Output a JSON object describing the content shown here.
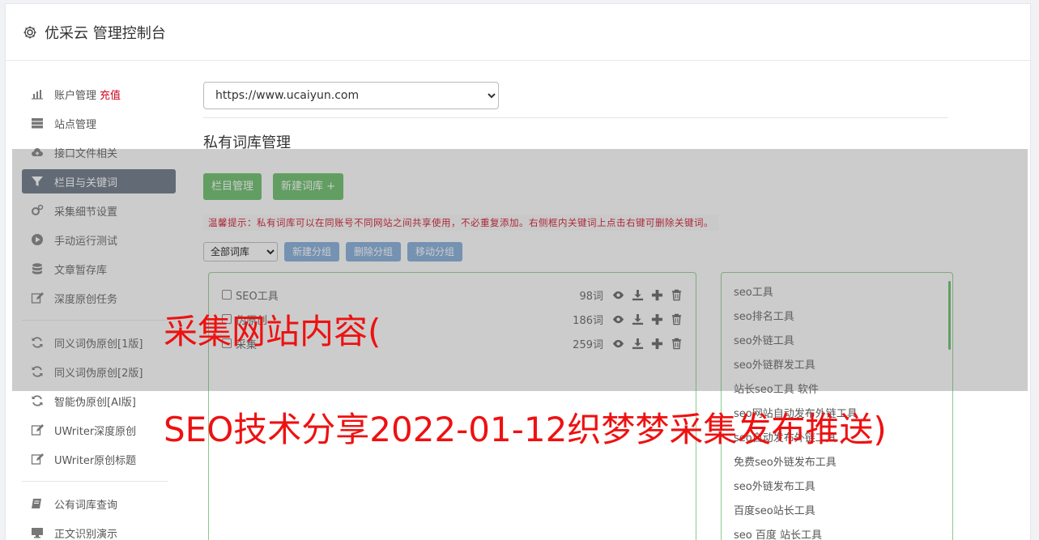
{
  "header": {
    "title": "优采云 管理控制台"
  },
  "sidebar": {
    "group1": [
      {
        "label": "账户管理",
        "extra": "充值",
        "icon": "bar-chart-icon"
      },
      {
        "label": "站点管理",
        "icon": "server-icon"
      },
      {
        "label": "接口文件相关",
        "icon": "cloud-upload-icon"
      },
      {
        "label": "栏目与关键词",
        "icon": "filter-icon",
        "active": true
      },
      {
        "label": "采集细节设置",
        "icon": "gears-icon"
      },
      {
        "label": "手动运行测试",
        "icon": "play-circle-icon"
      },
      {
        "label": "文章暂存库",
        "icon": "database-icon"
      },
      {
        "label": "深度原创任务",
        "icon": "edit-icon"
      }
    ],
    "group2": [
      {
        "label": "同义词伪原创[1版]",
        "icon": "refresh-icon"
      },
      {
        "label": "同义词伪原创[2版]",
        "icon": "refresh-icon"
      },
      {
        "label": "智能伪原创[AI版]",
        "icon": "refresh-icon"
      },
      {
        "label": "UWriter深度原创",
        "icon": "edit-icon"
      },
      {
        "label": "UWriter原创标题",
        "icon": "edit-icon"
      }
    ],
    "group3": [
      {
        "label": "公有词库查询",
        "icon": "book-icon"
      },
      {
        "label": "正文识别演示",
        "icon": "monitor-icon"
      }
    ]
  },
  "main": {
    "site_select": "https://www.ucaiyun.com",
    "section_title": "私有词库管理",
    "btn_columns": "栏目管理",
    "btn_new_lib": "新建词库 +",
    "tip": "温馨提示：私有词库可以在同账号不同网站之间共享使用，不必重复添加。右侧框内关键词上点击右键可删除关键词。",
    "lib_filter": "全部词库",
    "btn_new_group": "新建分组",
    "btn_delete_group": "删除分组",
    "btn_move_group": "移动分组",
    "libraries": [
      {
        "name": "SEO工具",
        "count": "98词"
      },
      {
        "name": "伪原创",
        "count": "186词"
      },
      {
        "name": "采集",
        "count": "259词"
      }
    ],
    "keywords": [
      "seo工具",
      "seo排名工具",
      "seo外链工具",
      "seo外链群发工具",
      "站长seo工具 软件",
      "seo网站自动发布外链工具",
      "seo自动发布外链工具",
      "免费seo外链发布工具",
      "seo外链发布工具",
      "百度seo站长工具",
      "seo 百度 站长工具"
    ]
  },
  "overlay": {
    "line1": "采集网站内容(",
    "line2": "SEO技术分享2022-01-12织梦梦采集发布推送)"
  }
}
